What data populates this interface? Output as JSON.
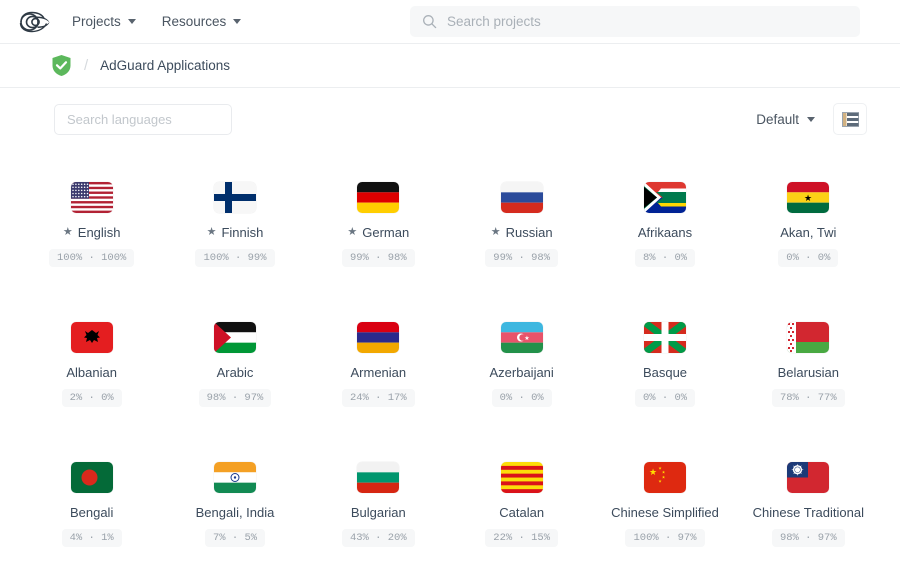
{
  "navbar": {
    "logo_icon": "weblate-logo-icon",
    "items": [
      {
        "label": "Projects",
        "icon": "chevron-down-icon"
      },
      {
        "label": "Resources",
        "icon": "chevron-down-icon"
      }
    ],
    "search": {
      "placeholder": "Search projects",
      "value": "",
      "icon": "search-icon"
    }
  },
  "breadcrumb": {
    "status_icon": "green-shield-check-icon",
    "separator": "/",
    "project": "AdGuard Applications"
  },
  "controls": {
    "language_search": {
      "placeholder": "Search languages",
      "value": ""
    },
    "sort": {
      "label": "Default",
      "icon": "chevron-down-icon"
    },
    "view_toggle": {
      "icon": "list-view-icon"
    }
  },
  "languages": [
    {
      "name": "English",
      "flag": "us",
      "starred": true,
      "star": "★",
      "translated": "100%",
      "approved": "100%",
      "pct": "100% · 100%"
    },
    {
      "name": "Finnish",
      "flag": "fi",
      "starred": true,
      "star": "★",
      "translated": "100%",
      "approved": "99%",
      "pct": "100% · 99%"
    },
    {
      "name": "German",
      "flag": "de",
      "starred": true,
      "star": "★",
      "translated": "99%",
      "approved": "98%",
      "pct": "99% · 98%"
    },
    {
      "name": "Russian",
      "flag": "ru",
      "starred": true,
      "star": "★",
      "translated": "99%",
      "approved": "98%",
      "pct": "99% · 98%"
    },
    {
      "name": "Afrikaans",
      "flag": "za",
      "starred": false,
      "star": "",
      "translated": "8%",
      "approved": "0%",
      "pct": "8% · 0%"
    },
    {
      "name": "Akan, Twi",
      "flag": "gh",
      "starred": false,
      "star": "",
      "translated": "0%",
      "approved": "0%",
      "pct": "0% · 0%"
    },
    {
      "name": "Albanian",
      "flag": "al",
      "starred": false,
      "star": "",
      "translated": "2%",
      "approved": "0%",
      "pct": "2% · 0%"
    },
    {
      "name": "Arabic",
      "flag": "ps",
      "starred": false,
      "star": "",
      "translated": "98%",
      "approved": "97%",
      "pct": "98% · 97%"
    },
    {
      "name": "Armenian",
      "flag": "am",
      "starred": false,
      "star": "",
      "translated": "24%",
      "approved": "17%",
      "pct": "24% · 17%"
    },
    {
      "name": "Azerbaijani",
      "flag": "az",
      "starred": false,
      "star": "",
      "translated": "0%",
      "approved": "0%",
      "pct": "0% · 0%"
    },
    {
      "name": "Basque",
      "flag": "eu",
      "starred": false,
      "star": "",
      "translated": "0%",
      "approved": "0%",
      "pct": "0% · 0%"
    },
    {
      "name": "Belarusian",
      "flag": "by",
      "starred": false,
      "star": "",
      "translated": "78%",
      "approved": "77%",
      "pct": "78% · 77%"
    },
    {
      "name": "Bengali",
      "flag": "bd",
      "starred": false,
      "star": "",
      "translated": "4%",
      "approved": "1%",
      "pct": "4% · 1%"
    },
    {
      "name": "Bengali, India",
      "flag": "in",
      "starred": false,
      "star": "",
      "translated": "7%",
      "approved": "5%",
      "pct": "7% · 5%"
    },
    {
      "name": "Bulgarian",
      "flag": "bg",
      "starred": false,
      "star": "",
      "translated": "43%",
      "approved": "20%",
      "pct": "43% · 20%"
    },
    {
      "name": "Catalan",
      "flag": "ct",
      "starred": false,
      "star": "",
      "translated": "22%",
      "approved": "15%",
      "pct": "22% · 15%"
    },
    {
      "name": "Chinese Simplified",
      "flag": "cn",
      "starred": false,
      "star": "",
      "translated": "100%",
      "approved": "97%",
      "pct": "100% · 97%"
    },
    {
      "name": "Chinese Traditional",
      "flag": "tw",
      "starred": false,
      "star": "",
      "translated": "98%",
      "approved": "97%",
      "pct": "98% · 97%"
    }
  ],
  "colors": {
    "text": "#3c4b5c",
    "muted": "#9aa2aa",
    "shield_green": "#5cb85c",
    "badge_bg": "#f6f7f8",
    "border": "#eceef0"
  }
}
